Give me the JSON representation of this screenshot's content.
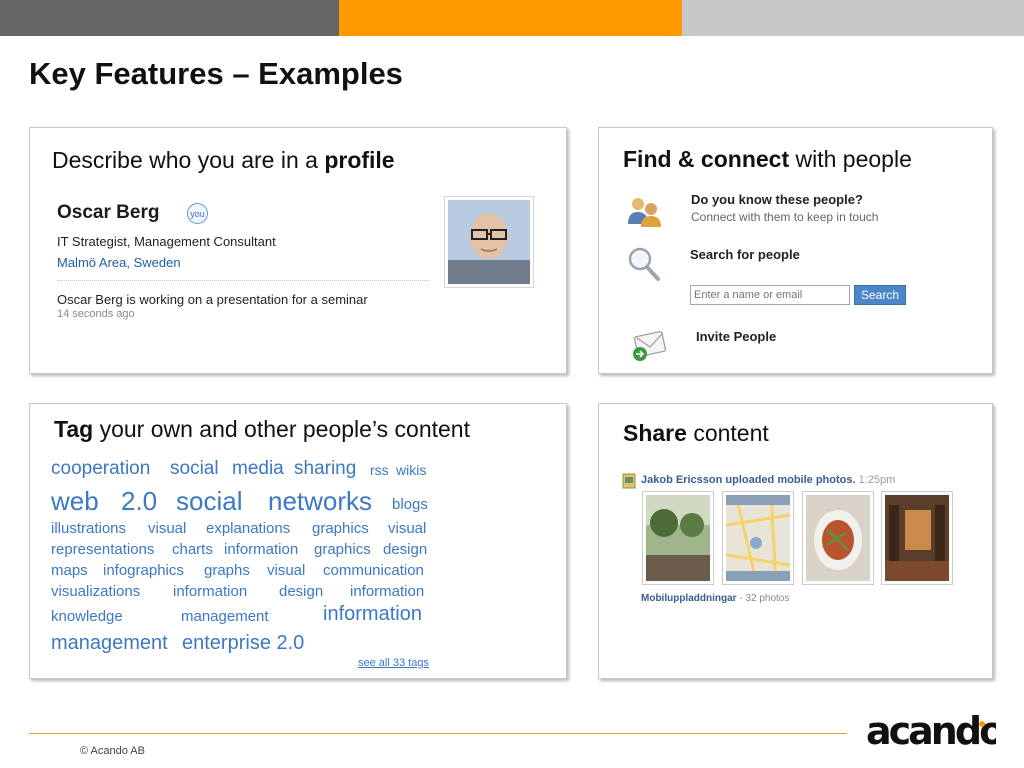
{
  "colors": {
    "bar_left": "#666666",
    "bar_mid": "#ff9900",
    "bar_right": "#c8c8c8",
    "link": "#3c78c3",
    "accent_line": "#e9a12a"
  },
  "slide": {
    "title": "Key Features – Examples"
  },
  "profile": {
    "heading_pre": "Describe who you are in a ",
    "heading_bold": "profile",
    "name": "Oscar Berg",
    "badge": "you",
    "job": "IT Strategist, Management Consultant",
    "location": "Malmö Area, Sweden",
    "status": "Oscar Berg is working on a presentation for a seminar",
    "time": "14 seconds ago"
  },
  "find": {
    "heading_bold": "Find & connect",
    "heading_rest": " with people",
    "question": "Do you know these people?",
    "question_sub": "Connect with them to keep in touch",
    "search_label": "Search for people",
    "search_placeholder": "Enter a name or email",
    "search_button": "Search",
    "invite": "Invite People"
  },
  "tags": {
    "heading_bold": "Tag",
    "heading_rest": " your own and other people’s content",
    "see_all": "see all 33 tags",
    "items": [
      "cooperation",
      "social",
      "media",
      "sharing",
      "rss",
      "wikis",
      "web",
      "2.0",
      "social",
      "networks",
      "blogs",
      "illustrations",
      "visual",
      "explanations",
      "graphics",
      "visual",
      "representations",
      "charts",
      "information",
      "graphics",
      "design",
      "maps",
      "infographics",
      "graphs",
      "visual",
      "communication",
      "visualizations",
      "information",
      "design",
      "information",
      "knowledge",
      "management",
      "information",
      "management",
      "enterprise 2.0"
    ]
  },
  "share": {
    "heading_bold": "Share",
    "heading_rest": " content",
    "poster": "Jakob Ericsson",
    "action": " uploaded mobile photos.",
    "time": "1:25pm",
    "album": "Mobiluppladdningar",
    "album_count": " - 32 photos"
  },
  "footer": {
    "copyright": "© Acando AB",
    "logo_text": "acando"
  }
}
